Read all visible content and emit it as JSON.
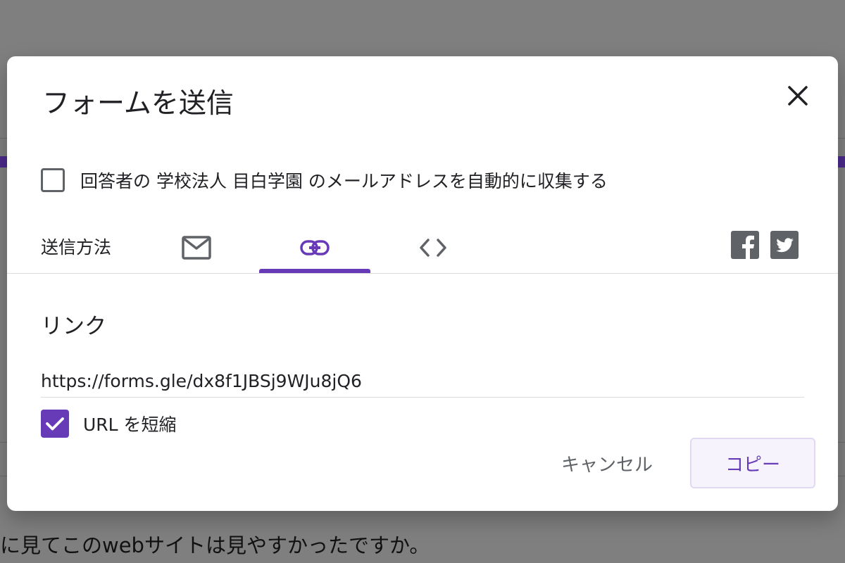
{
  "dialog": {
    "title": "フォームを送信",
    "collect_email_label": "回答者の 学校法人 目白学園 のメールアドレスを自動的に収集する",
    "collect_email_checked": false,
    "send_via_label": "送信方法",
    "tabs": [
      {
        "icon": "mail-icon",
        "selected": false
      },
      {
        "icon": "link-icon",
        "selected": true
      },
      {
        "icon": "embed-code-icon",
        "selected": false
      }
    ],
    "social": [
      "facebook-icon",
      "twitter-icon"
    ],
    "section_title": "リンク",
    "url_value": "https://forms.gle/dx8f1JBSj9WJu8jQ6",
    "shorten_url_label": "URL を短縮",
    "shorten_url_checked": true,
    "cancel_label": "キャンセル",
    "copy_label": "コピー"
  },
  "background": {
    "bottom_text": "に見てこのwebサイトは見やすかったですか。"
  },
  "colors": {
    "accent": "#673ab7",
    "overlay": "#7f7f7f",
    "icon_gray": "#5f6368"
  }
}
